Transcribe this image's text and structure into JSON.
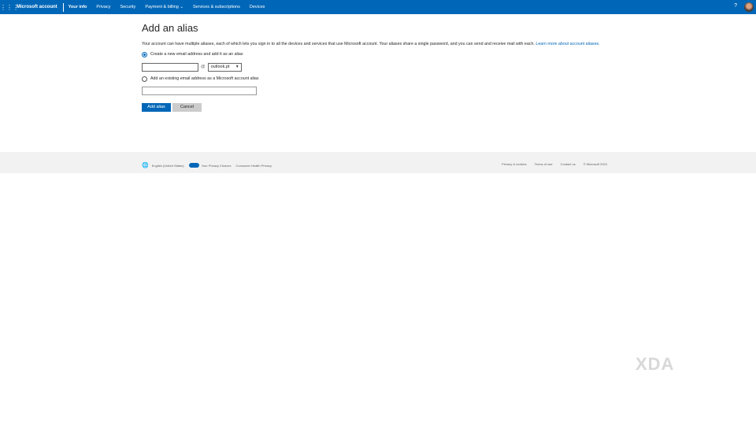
{
  "nav": {
    "brand": "Microsoft account",
    "items": [
      "Your info",
      "Privacy",
      "Security",
      "Payment & billing",
      "Services & subscriptions",
      "Devices"
    ],
    "help": "?"
  },
  "main": {
    "title": "Add an alias",
    "description": "Your account can have multiple aliases, each of which lets you sign in to all the devices and services that use Microsoft account. Your aliases share a single password, and you can send and receive mail with each.",
    "learn_more": "Learn more about account aliases.",
    "option1": "Create a new email address and add it as an alias",
    "at": "@",
    "domain": "outlook.pt",
    "option2": "Add an existing email address as a Microsoft account alias",
    "add_button": "Add alias",
    "cancel_button": "Cancel"
  },
  "footer": {
    "language": "English (United States)",
    "privacy_choices": "Your Privacy Choices",
    "health_privacy": "Consumer Health Privacy",
    "links": [
      "Privacy & cookies",
      "Terms of use",
      "Contact us",
      "© Microsoft 2024"
    ]
  },
  "watermark": "XDA"
}
